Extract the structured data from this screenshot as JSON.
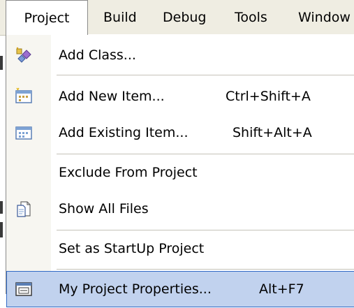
{
  "menubar": {
    "items": [
      {
        "label": "Project"
      },
      {
        "label": "Build"
      },
      {
        "label": "Debug"
      },
      {
        "label": "Tools"
      },
      {
        "label": "Window"
      }
    ]
  },
  "menu": {
    "add_class": {
      "label": "Add Class...",
      "icon": "add-class-icon"
    },
    "add_new_item": {
      "label": "Add New Item...",
      "shortcut": "Ctrl+Shift+A",
      "icon": "add-new-item-icon"
    },
    "add_existing_item": {
      "label": "Add Existing Item...",
      "shortcut": "Shift+Alt+A",
      "icon": "add-existing-item-icon"
    },
    "exclude_from_project": {
      "label": "Exclude From Project"
    },
    "show_all_files": {
      "label": "Show All Files",
      "icon": "show-all-files-icon"
    },
    "set_as_startup": {
      "label": "Set as StartUp Project"
    },
    "my_project_properties": {
      "label": "My Project Properties...",
      "shortcut": "Alt+F7",
      "icon": "properties-icon"
    }
  },
  "colors": {
    "menubar_bg": "#efede2",
    "gutter_bg": "#f7f6f1",
    "highlight_bg": "#c1d2ee",
    "highlight_border": "#316ac5"
  }
}
